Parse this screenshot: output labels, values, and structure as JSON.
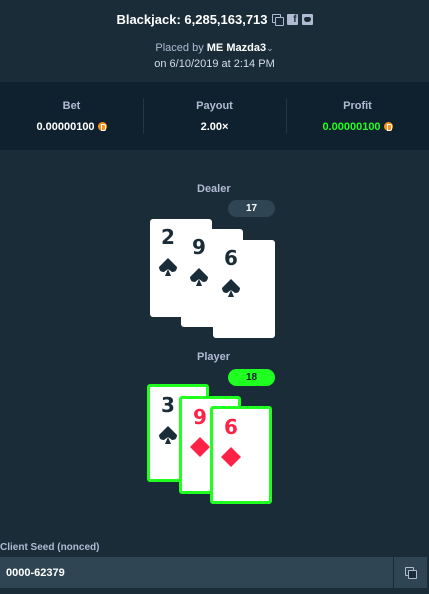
{
  "header": {
    "title": "Blackjack: 6,285,163,713",
    "placed_prefix": "Placed by",
    "user": "ME Mazda3",
    "date": "on 6/10/2019 at 2:14 PM"
  },
  "stats": {
    "bet_label": "Bet",
    "bet_value": "0.00000100",
    "payout_label": "Payout",
    "payout_value": "2.00×",
    "profit_label": "Profit",
    "profit_value": "0.00000100"
  },
  "dealer": {
    "label": "Dealer",
    "score": "17",
    "cards": [
      {
        "rank": "2",
        "suit": "spade-icon"
      },
      {
        "rank": "9",
        "suit": "spade-icon"
      },
      {
        "rank": "6",
        "suit": "spade-icon"
      }
    ]
  },
  "player": {
    "label": "Player",
    "score": "18",
    "cards": [
      {
        "rank": "3",
        "suit": "spade-icon"
      },
      {
        "rank": "9",
        "suit": "diamond-icon"
      },
      {
        "rank": "6",
        "suit": "diamond-icon"
      }
    ]
  },
  "seed": {
    "label": "Client Seed (nonced)",
    "value": "0000-62379"
  },
  "colors": {
    "background": "#1a2c38",
    "panel": "#0f212e",
    "win_green": "#1fff20",
    "red_suit": "#fe2247",
    "coin": "#f7931a"
  }
}
